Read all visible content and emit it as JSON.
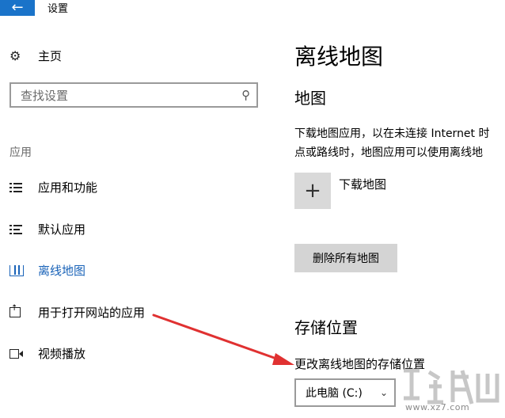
{
  "window": {
    "title": "设置",
    "back_icon": "arrow-left-icon"
  },
  "sidebar": {
    "home_label": "主页",
    "search_placeholder": "查找设置",
    "section_label": "应用",
    "items": [
      {
        "label": "应用和功能",
        "icon": "apps-list-icon",
        "active": false
      },
      {
        "label": "默认应用",
        "icon": "default-apps-icon",
        "active": false
      },
      {
        "label": "离线地图",
        "icon": "map-icon",
        "active": true
      },
      {
        "label": "用于打开网站的应用",
        "icon": "open-web-icon",
        "active": false
      },
      {
        "label": "视频播放",
        "icon": "video-icon",
        "active": false
      }
    ]
  },
  "main": {
    "title": "离线地图",
    "maps_heading": "地图",
    "description_line1": "下载地图应用，以在未连接 Internet 时",
    "description_line2": "点或路线时，地图应用可以使用离线地",
    "download_label": "下载地图",
    "delete_button": "删除所有地图",
    "storage_heading": "存储位置",
    "storage_change_label": "更改离线地图的存储位置",
    "storage_selected": "此电脑 (C:)"
  },
  "colors": {
    "accent": "#1a63b8",
    "back_button": "#1a73c9",
    "arrow": "#e03131"
  },
  "watermark": {
    "text": "www.xz7.com"
  }
}
